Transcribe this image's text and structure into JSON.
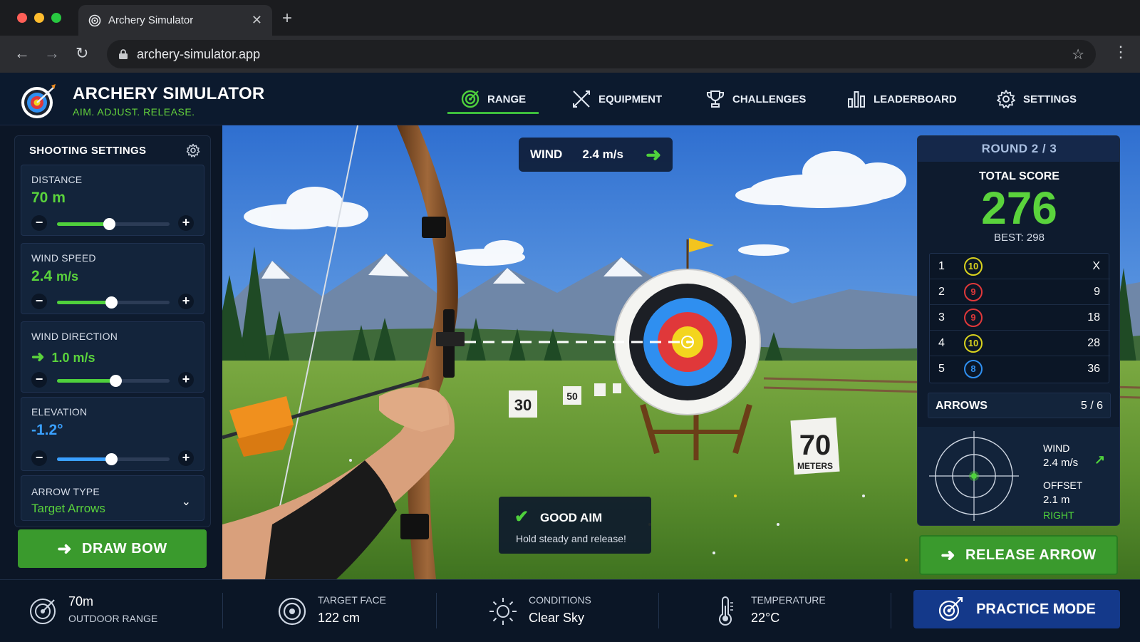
{
  "browser": {
    "tab_title": "Archery Simulator",
    "url": "archery-simulator.app"
  },
  "app": {
    "title": "ARCHERY SIMULATOR",
    "tagline": "AIM. ADJUST. RELEASE.",
    "nav": [
      {
        "label": "RANGE",
        "icon": "target-icon",
        "active": true
      },
      {
        "label": "EQUIPMENT",
        "icon": "crossed-arrows-icon",
        "active": false
      },
      {
        "label": "CHALLENGES",
        "icon": "trophy-icon",
        "active": false
      },
      {
        "label": "LEADERBOARD",
        "icon": "bar-chart-icon",
        "active": false
      },
      {
        "label": "SETTINGS",
        "icon": "gear-icon",
        "active": false
      }
    ]
  },
  "settings": {
    "title": "SHOOTING SETTINGS",
    "distance": {
      "label": "DISTANCE",
      "value": "70 m",
      "slider": 0.46
    },
    "wind_speed": {
      "label": "WIND SPEED",
      "value": "2.4",
      "unit": "m/s",
      "slider": 0.48
    },
    "wind_direction": {
      "label": "WIND DIRECTION",
      "value": "1.0 m/s",
      "slider": 0.52
    },
    "elevation": {
      "label": "ELEVATION",
      "value": "-1.2°",
      "slider": 0.48
    },
    "arrow_type": {
      "label": "ARROW TYPE",
      "value": "Target Arrows"
    },
    "draw_label": "DRAW BOW"
  },
  "range": {
    "wind_label": "WIND",
    "wind_value": "2.4 m/s",
    "distance_markers": [
      "30",
      "50",
      "70"
    ],
    "sign_number": "70",
    "sign_unit": "METERS",
    "aim_title": "GOOD AIM",
    "aim_sub": "Hold steady and release!"
  },
  "score": {
    "round": "ROUND 2 / 3",
    "total_label": "TOTAL SCORE",
    "total": "276",
    "best": "BEST: 298",
    "ends": [
      {
        "n": "1",
        "score": "10",
        "cum": "X",
        "color": "#d9d21e"
      },
      {
        "n": "2",
        "score": "9",
        "cum": "9",
        "color": "#e0383a"
      },
      {
        "n": "3",
        "score": "9",
        "cum": "18",
        "color": "#e0383a"
      },
      {
        "n": "4",
        "score": "10",
        "cum": "28",
        "color": "#d9d21e"
      },
      {
        "n": "5",
        "score": "8",
        "cum": "36",
        "color": "#2f8ff0"
      }
    ],
    "arrows_label": "ARROWS",
    "arrows_value": "5 / 6",
    "wind_label": "WIND",
    "wind_value": "2.4 m/s",
    "offset_label": "OFFSET",
    "offset_value": "2.1 m",
    "offset_dir": "RIGHT",
    "release_label": "RELEASE ARROW"
  },
  "footer": {
    "range_value": "70m",
    "range_label": "OUTDOOR RANGE",
    "face_label": "TARGET FACE",
    "face_value": "122 cm",
    "cond_label": "CONDITIONS",
    "cond_value": "Clear Sky",
    "temp_label": "TEMPERATURE",
    "temp_value": "22°C",
    "practice_label": "PRACTICE MODE"
  },
  "colors": {
    "accent_green": "#5ad33c",
    "accent_blue": "#3aa0ff",
    "button_green": "#3a9a2d",
    "practice_blue": "#14398a"
  }
}
